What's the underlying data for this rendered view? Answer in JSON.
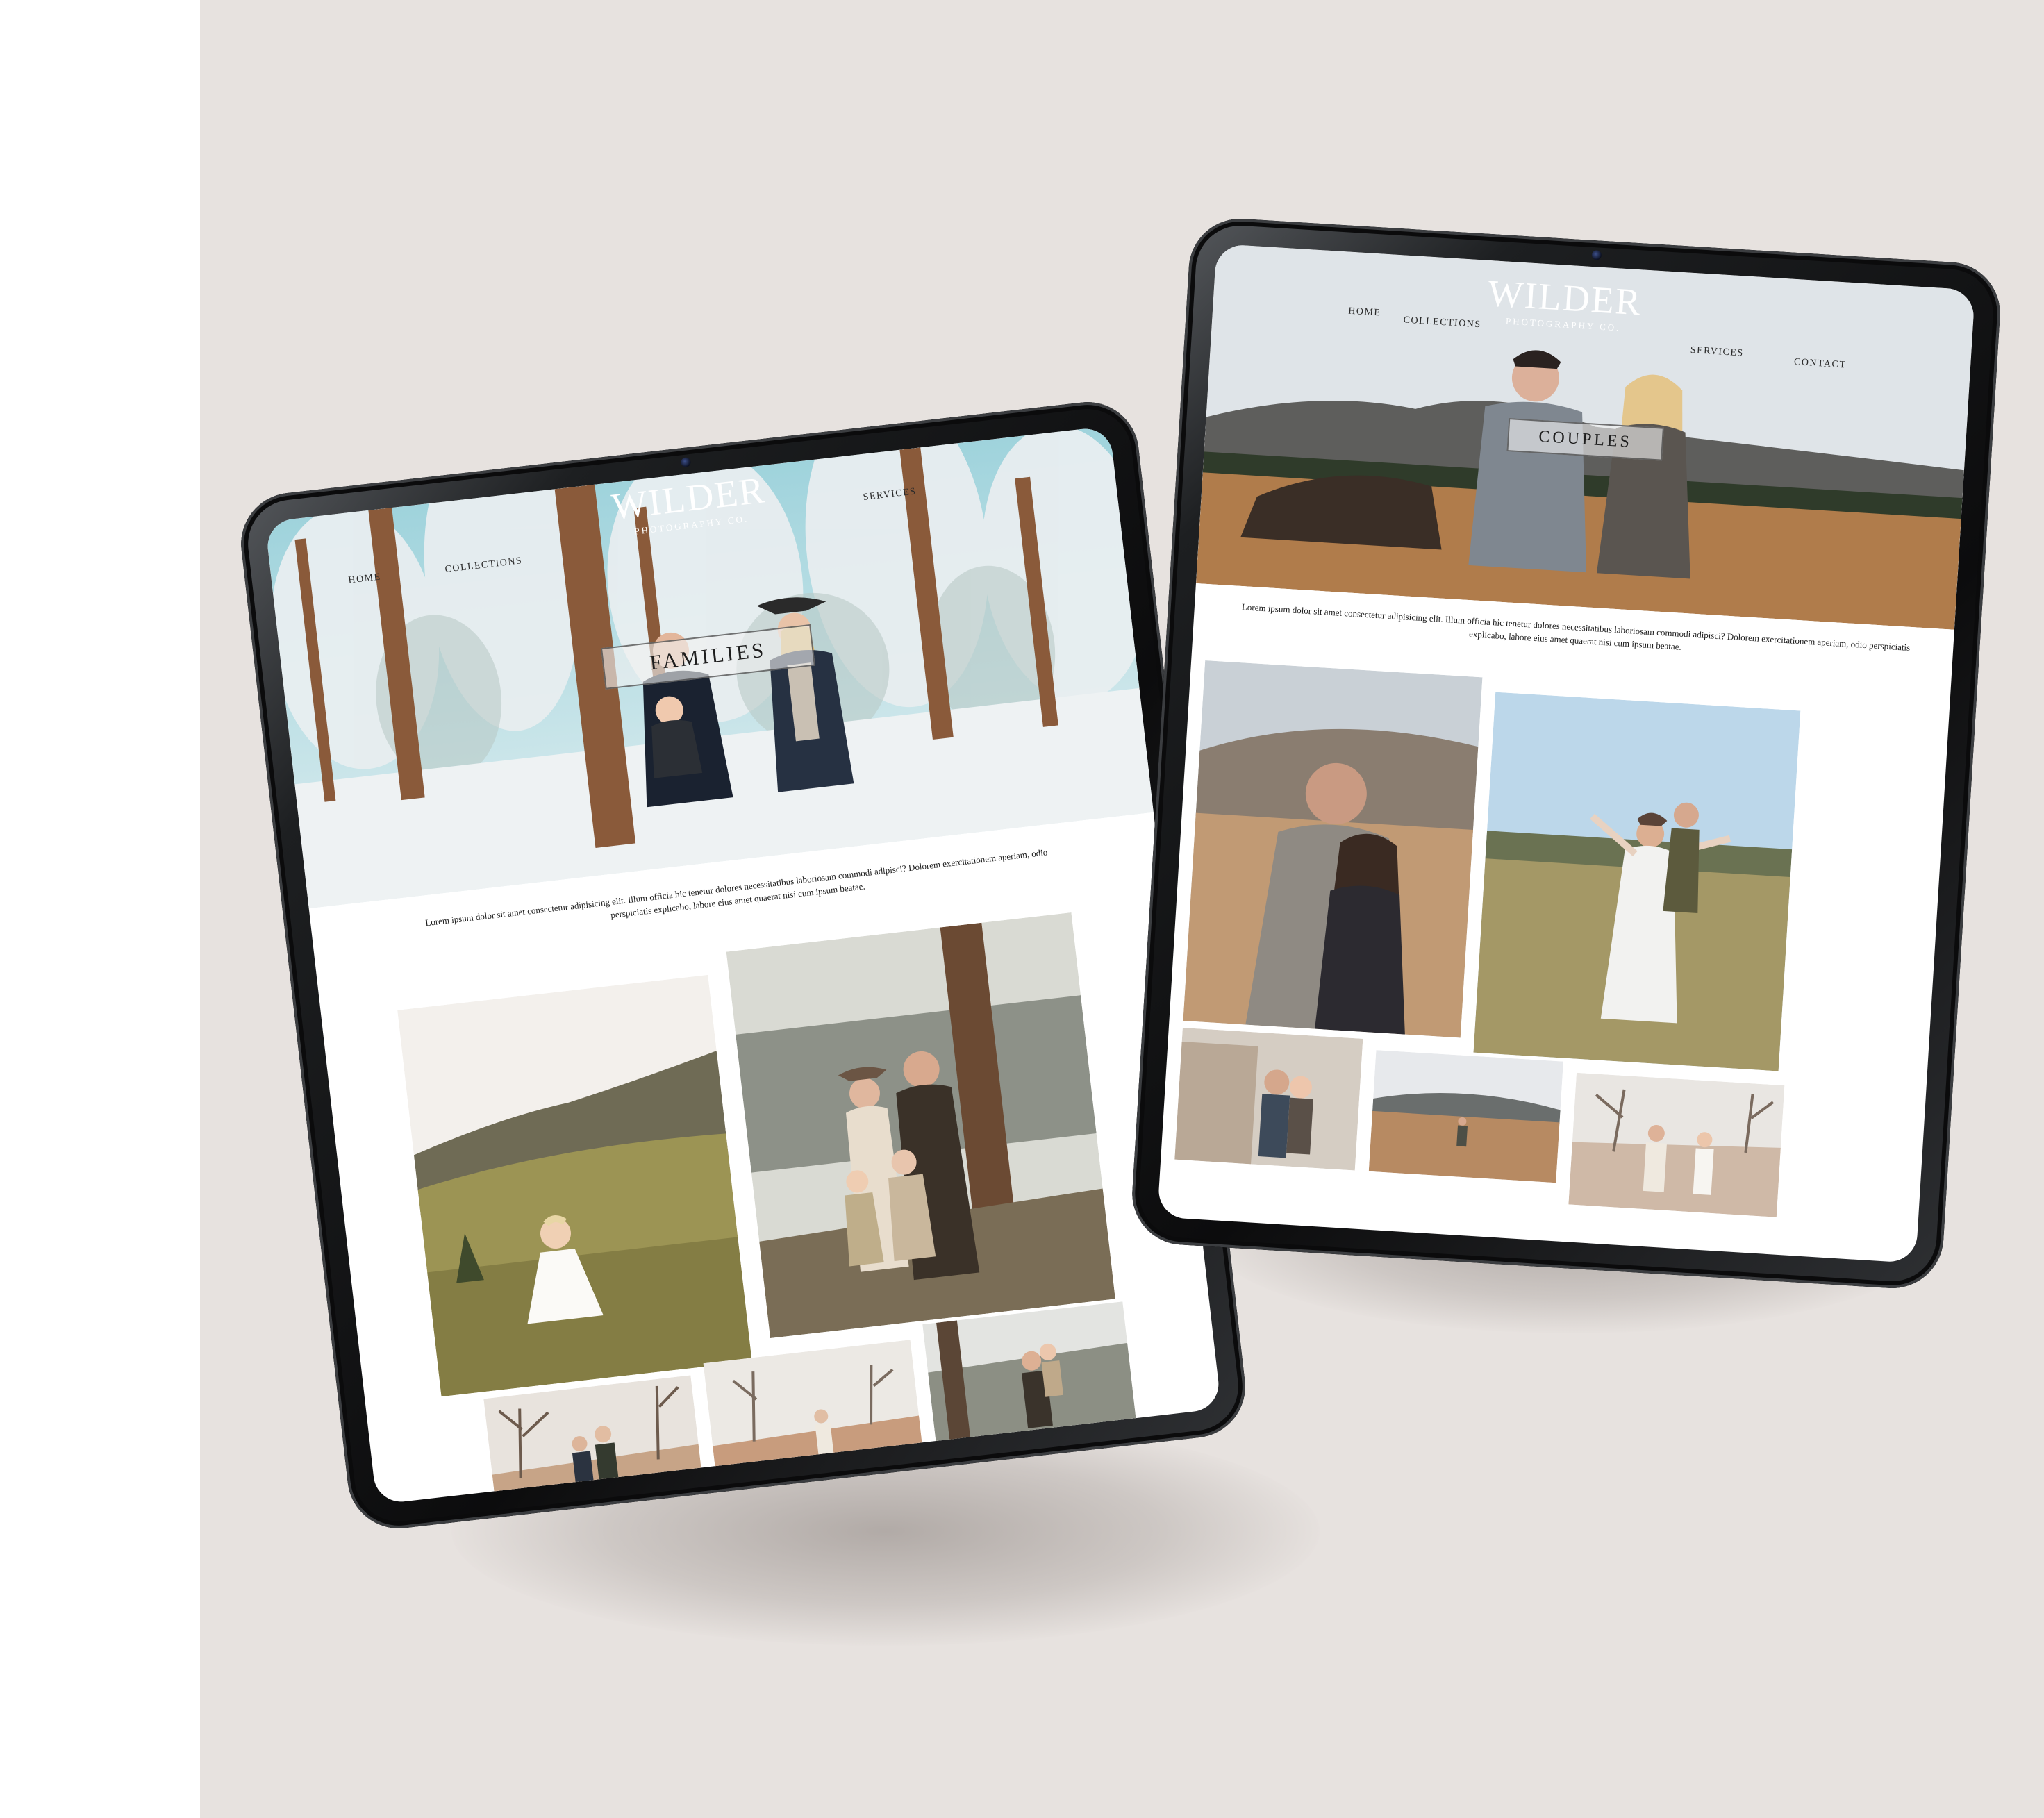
{
  "site": {
    "logo_word": "WILDER",
    "logo_sub": "PHOTOGRAPHY CO.",
    "intro_text": "Lorem ipsum dolor sit amet consectetur adipisicing elit. Illum officia hic tenetur dolores necessitatibus laboriosam commodi adipisci? Dolorem exercitationem aperiam, odio perspiciatis explicabo, labore eius amet quaerat nisi cum ipsum beatae."
  },
  "families_tablet": {
    "nav": {
      "home": "HOME",
      "collections": "COLLECTIONS",
      "services": "SERVICES"
    },
    "hero_title": "FAMILIES"
  },
  "couples_tablet": {
    "nav": {
      "home": "HOME",
      "collections": "COLLECTIONS",
      "services": "SERVICES",
      "contact": "CONTACT"
    },
    "hero_title": "COUPLES"
  },
  "colors": {
    "background": "#e7e2df",
    "tablet_frame": "#111213",
    "accent_text": "#1e1e1e"
  }
}
